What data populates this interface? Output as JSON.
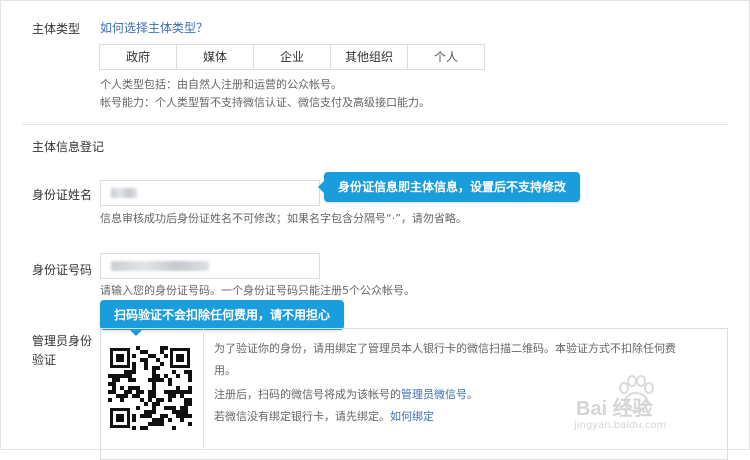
{
  "entity_type": {
    "label": "主体类型",
    "help_link": "如何选择主体类型？",
    "tabs": [
      "政府",
      "媒体",
      "企业",
      "其他组织",
      "个人"
    ],
    "selected": "个人",
    "desc_line1": "个人类型包括：由自然人注册和运营的公众帐号。",
    "desc_line2": "帐号能力：个人类型暂不支持微信认证、微信支付及高级接口能力。"
  },
  "section_title": "主体信息登记",
  "id_name": {
    "label": "身份证姓名",
    "hint": "信息审核成功后身份证姓名不可修改；如果名字包含分隔号“·”，请勿省略。"
  },
  "callout_top": "身份证信息即主体信息，设置后不支持修改",
  "id_number": {
    "label": "身份证号码",
    "hint": "请输入您的身份证号码。一个身份证号码只能注册5个公众帐号。"
  },
  "callout_bottom": "扫码验证不会扣除任何费用，请不用担心",
  "admin": {
    "label_line1": "管理员身份",
    "label_line2": "验证",
    "text1_line1": "为了验证你的身份，请用绑定了管理员本人银行卡的微信扫描二维码。本验证方式不扣除任何费",
    "text1_line2": "用。",
    "text2_prefix": "注册后，扫码的微信号将成为该帐号的",
    "text2_link": "管理员微信号",
    "text2_suffix": "。",
    "text3_prefix": "若微信没有绑定银行卡，请先绑定。",
    "text3_link": "如何绑定"
  },
  "watermark": {
    "brand": "Bai 经验",
    "url": "jingyan.baidu.com",
    "icon": "baidu-paw-icon"
  }
}
